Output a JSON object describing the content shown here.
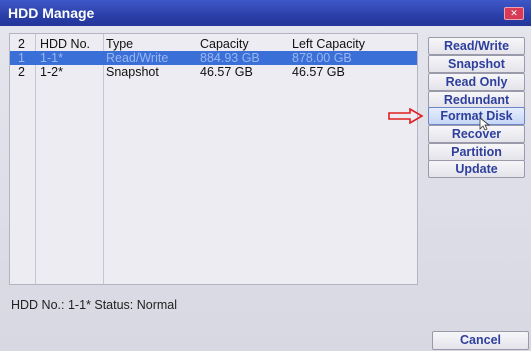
{
  "window": {
    "title": "HDD Manage",
    "close_glyph": "✕"
  },
  "table": {
    "count": "2",
    "headers": [
      "HDD No.",
      "Type",
      "Capacity",
      "Left Capacity"
    ],
    "rows": [
      {
        "index": "1",
        "hdd_no": "1-1*",
        "type": "Read/Write",
        "capacity": "884.93 GB",
        "left_capacity": "878.00 GB",
        "selected": true
      },
      {
        "index": "2",
        "hdd_no": "1-2*",
        "type": "Snapshot",
        "capacity": "46.57 GB",
        "left_capacity": "46.57 GB",
        "selected": false
      }
    ]
  },
  "buttons": {
    "read_write": "Read/Write",
    "snapshot": "Snapshot",
    "read_only": "Read Only",
    "redundant": "Redundant",
    "format_disk": "Format Disk",
    "recover": "Recover",
    "partition": "Partition",
    "update": "Update"
  },
  "status": {
    "text": "HDD No.: 1-1* Status: Normal"
  },
  "footer": {
    "cancel": "Cancel"
  },
  "colors": {
    "title_bar": "#2a3fa8",
    "selection": "#3a6fd8",
    "button_text": "#2e3f9c",
    "annotation_arrow": "#e02020"
  },
  "icons": {
    "annotation": "red-arrow-icon",
    "pointer": "mouse-cursor-icon",
    "close": "close-icon"
  }
}
